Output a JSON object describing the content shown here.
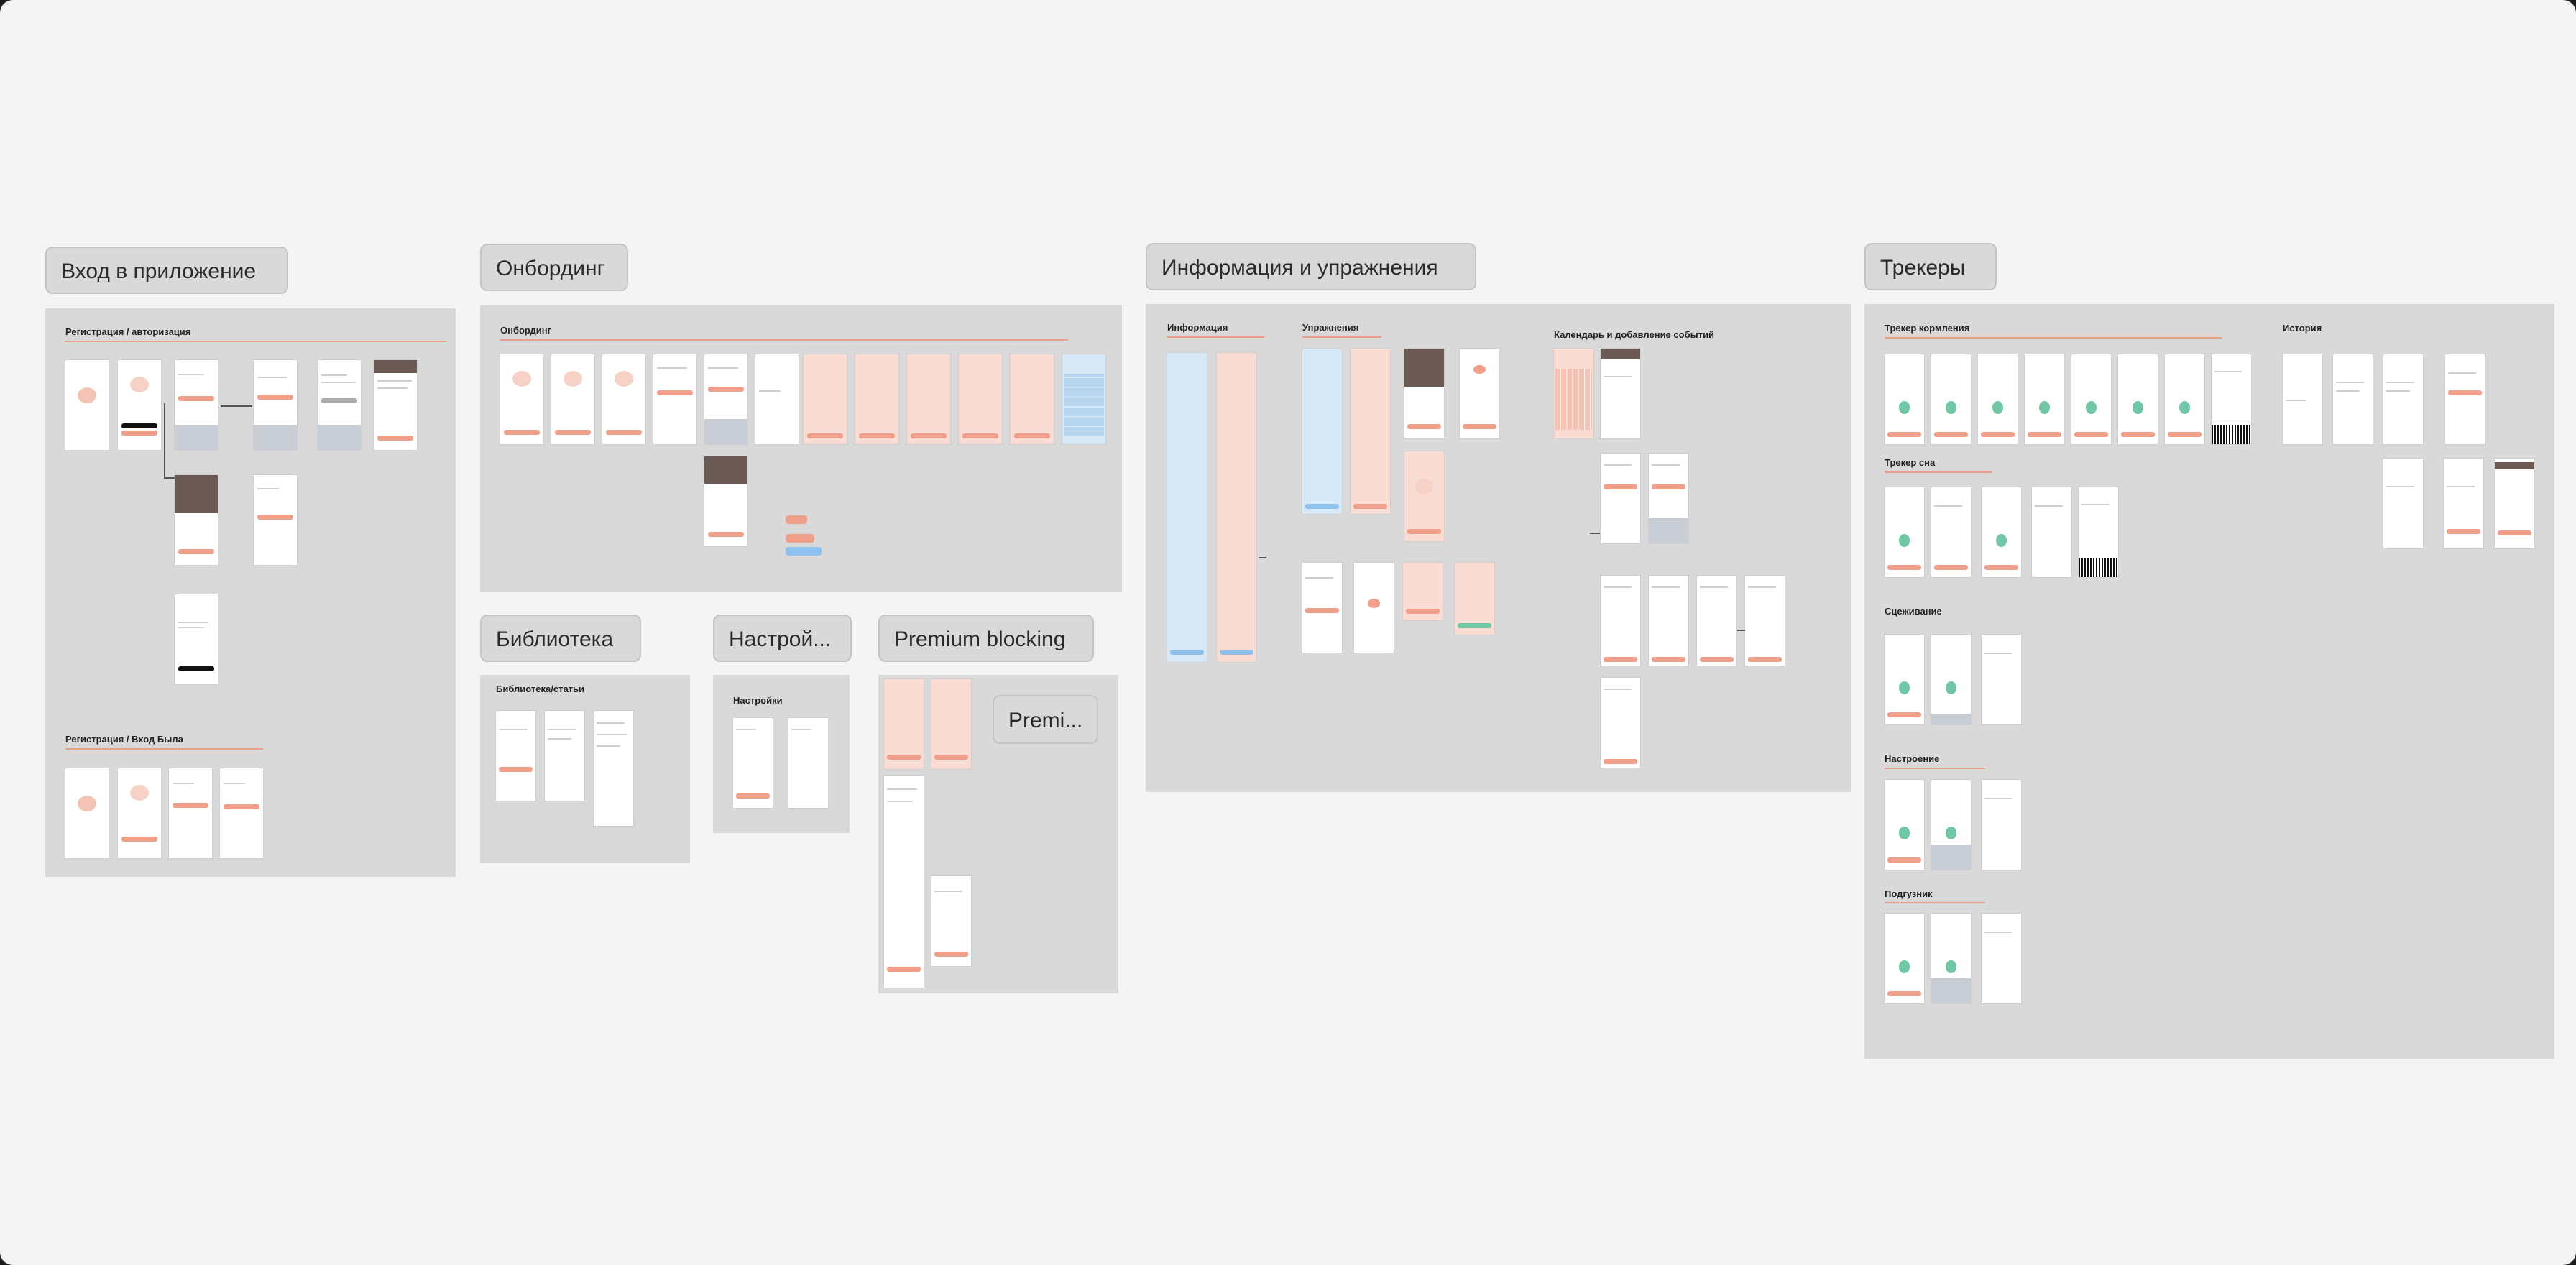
{
  "sections": {
    "entry": {
      "title": "Вход в приложение",
      "sub1": "Регистрация / авторизация",
      "sub2": "Регистрация / Вход Была"
    },
    "onboarding": {
      "title": "Онбординг",
      "sub": "Онбординг"
    },
    "info": {
      "title": "Информация и упражнения",
      "sub_info": "Информация",
      "sub_exercises": "Упражнения",
      "sub_calendar": "Календарь и добавление событий"
    },
    "trackers": {
      "title": "Трекеры",
      "sub_feeding": "Трекер кормления",
      "sub_history": "История",
      "sub_sleep": "Трекер сна",
      "sub_pumping": "Сцеживание",
      "sub_settings": "Настроение",
      "sub_food": "Подгузник"
    },
    "library": {
      "title": "Библиотека",
      "sub": "Библиотека/статьи"
    },
    "settings": {
      "title": "Настрой...",
      "sub": "Настройки"
    },
    "premium": {
      "title": "Premium blocking",
      "inner": "Premi..."
    }
  },
  "colors": {
    "canvas": "#f4f4f4",
    "panel": "#d9d9d9",
    "accent": "#f0a08a",
    "pink_screen": "#f9dcd3",
    "blue_screen": "#d7e9f7",
    "green": "#6fc7a6",
    "dark_header": "#6b5a54"
  }
}
